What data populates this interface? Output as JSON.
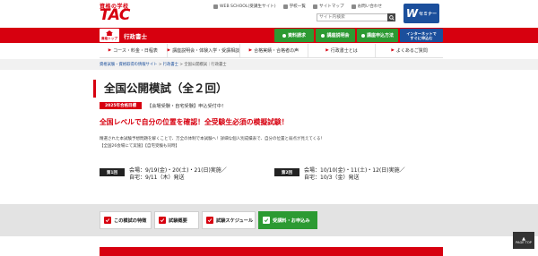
{
  "header": {
    "logo_sub": "資格の学校",
    "logo_main": "TAC",
    "util_links": [
      {
        "label": "WEB SCHOOL(受講生サイト)",
        "icon": "web-icon"
      },
      {
        "label": "学校一覧",
        "icon": "school-icon"
      },
      {
        "label": "サイトマップ",
        "icon": "sitemap-icon"
      },
      {
        "label": "お問い合わせ",
        "icon": "mail-icon"
      }
    ],
    "search_placeholder": "サイト内検索",
    "w_seminar_w": "W",
    "w_seminar_label": "セミナー"
  },
  "redbar": {
    "home_label": "資格トップ",
    "section_title": "行政書士",
    "buttons": [
      {
        "label": "資料請求"
      },
      {
        "label": "講座説明会"
      },
      {
        "label": "講座申込方法"
      }
    ],
    "blue_button_line1": "インターネットで",
    "blue_button_line2": "すぐに申込む"
  },
  "nav": {
    "items": [
      {
        "label": "コース・料金・日程表"
      },
      {
        "label": "講座説明会・体験入学・受講相談"
      },
      {
        "label": "合格実績・合格者の声"
      },
      {
        "label": "行政書士とは"
      },
      {
        "label": "よくあるご質問"
      }
    ]
  },
  "breadcrumb": {
    "lead": "資格試験・資格取得の情報サイト",
    "sep1": " > ",
    "mid": "行政書士",
    "sep2": " > ",
    "tail": "全国公開模試｜行政書士"
  },
  "main": {
    "title": "全国公開模試（全２回）",
    "badge": "2025年合格目標",
    "badge_text": "【会場受験・自宅受験】申込受付中！",
    "headline": "全国レベルで自分の位置を確認！全受験生必須の模擬試験！",
    "desc_line1": "精選された本試験予想問題を解くことで、万全の体制で本試験へ！詳細な個人別成績表で、自分の位置と弱点が見えてくる！",
    "desc_line2": "【全国26会場にて実施】【自宅受験も同時】",
    "rounds": [
      {
        "label": "第1回",
        "line1": "会場：9/19(金)・20(土)・21(日)実施／",
        "line2": "自宅：9/11（木）発送"
      },
      {
        "label": "第2回",
        "line1": "会場：10/10(金)・11(土)・12(日)実施／",
        "line2": "自宅：10/3（金）発送"
      }
    ]
  },
  "actions": [
    {
      "label": "この模試の特徴",
      "icon": "check-icon"
    },
    {
      "label": "試験概要",
      "icon": "check-icon"
    },
    {
      "label": "試験スケジュール",
      "icon": "check-icon"
    },
    {
      "label": "受講料・お申込み",
      "icon": "check-icon"
    }
  ],
  "page_top": {
    "arrow": "▲",
    "label": "PAGE TOP"
  },
  "colors": {
    "brand_red": "#d7000f",
    "green": "#2c9a32",
    "blue": "#1b4f9c"
  }
}
